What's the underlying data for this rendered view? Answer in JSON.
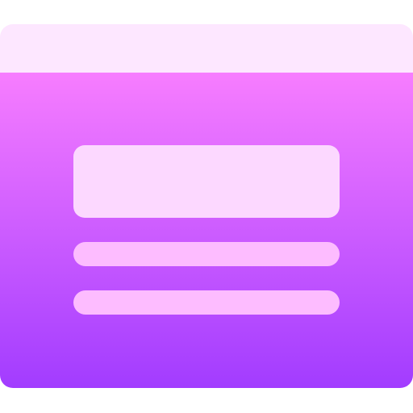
{
  "icon": {
    "name": "webpage-layout-icon",
    "colors": {
      "titlebar": "#fde7ff",
      "body_top": "#f77dff",
      "body_bottom": "#a23cff",
      "banner_block": "#fcd8ff",
      "text_line": "#fdbcff"
    }
  }
}
